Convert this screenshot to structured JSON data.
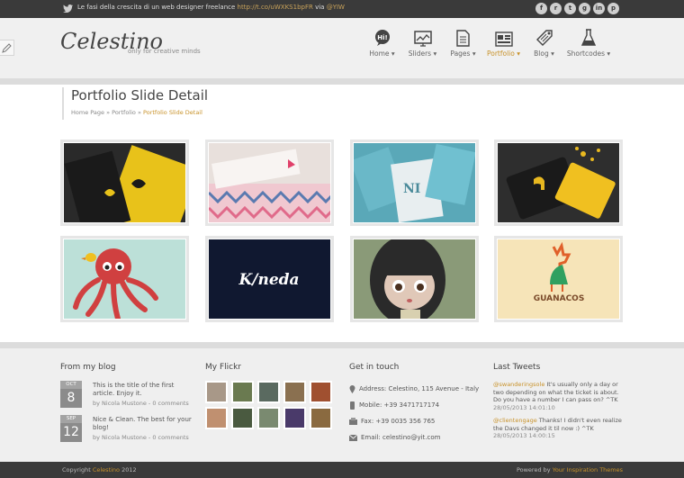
{
  "topbar": {
    "tweet_text": "Le fasi della crescita di un web designer freelance",
    "tweet_link": "http://t.co/uWXKS1bpFR",
    "tweet_via": "via",
    "tweet_handle": "@YIW",
    "socials": [
      "f",
      "r",
      "t",
      "g",
      "in",
      "p"
    ]
  },
  "header": {
    "logo": "Celestino",
    "tagline": "only for creative minds"
  },
  "nav": [
    {
      "label": "Home ▾",
      "icon": "speech-bubble-icon"
    },
    {
      "label": "Sliders ▾",
      "icon": "chart-icon"
    },
    {
      "label": "Pages ▾",
      "icon": "document-icon"
    },
    {
      "label": "Portfolio ▾",
      "icon": "portfolio-icon"
    },
    {
      "label": "Blog ▾",
      "icon": "tag-icon"
    },
    {
      "label": "Shortcodes ▾",
      "icon": "flask-icon"
    }
  ],
  "hi_badge": "Hi!",
  "page": {
    "title": "Portfolio Slide Detail",
    "breadcrumb_home": "Home Page",
    "breadcrumb_sep": "»",
    "breadcrumb_mid": "Portfolio",
    "breadcrumb_current": "Portfolio Slide Detail"
  },
  "portfolio": [
    {
      "name": "black-yellow-business-cards"
    },
    {
      "name": "pink-pattern-cards"
    },
    {
      "name": "blue-nautical-cards"
    },
    {
      "name": "yellow-black-tag"
    },
    {
      "name": "red-octopus"
    },
    {
      "name": "kineda-logo",
      "logo_text": "K/neda"
    },
    {
      "name": "doll-girl"
    },
    {
      "name": "guanacos-logo",
      "logo_text": "GUANACOS"
    }
  ],
  "footer": {
    "blog_title": "From my blog",
    "posts": [
      {
        "month": "OCT",
        "day": "8",
        "text": "This is the title of the first article. Enjoy it.",
        "meta": "by Nicola Mustone - 0 comments"
      },
      {
        "month": "SEP",
        "day": "12",
        "text": "Nice & Clean. The best for your blog!",
        "meta": "by Nicola Mustone - 0 comments"
      }
    ],
    "flickr_title": "My Flickr",
    "flickr_colors": [
      "#a89888",
      "#6a7a50",
      "#5a6a60",
      "#8a7050",
      "#a05030",
      "#c09070",
      "#4a5a40",
      "#7a8a70",
      "#4a3a6a",
      "#8a6a40"
    ],
    "contact_title": "Get in touch",
    "address": "Address: Celestino, 115 Avenue - Italy",
    "mobile": "Mobile: +39 3471717174",
    "fax": "Fax: +39 0035 356 765",
    "email": "Email: celestino@yit.com",
    "tweets_title": "Last Tweets",
    "tweets": [
      {
        "user": "@swanderingsole",
        "text": " It's usually only a day or two depending on what the ticket is about. Do you have a number I can pass on? ^TK",
        "time": "28/05/2013 14:01:10"
      },
      {
        "user": "@clientengage",
        "text": " Thanks! I didn't even realize the Davs changed it til now :) ^TK",
        "time": "28/05/2013 14:00:15"
      }
    ]
  },
  "copyright": {
    "left_prefix": "Copyright",
    "left_brand": "Celestino",
    "left_year": "2012",
    "right_prefix": "Powered by",
    "right_brand": "Your Inspiration Themes"
  }
}
